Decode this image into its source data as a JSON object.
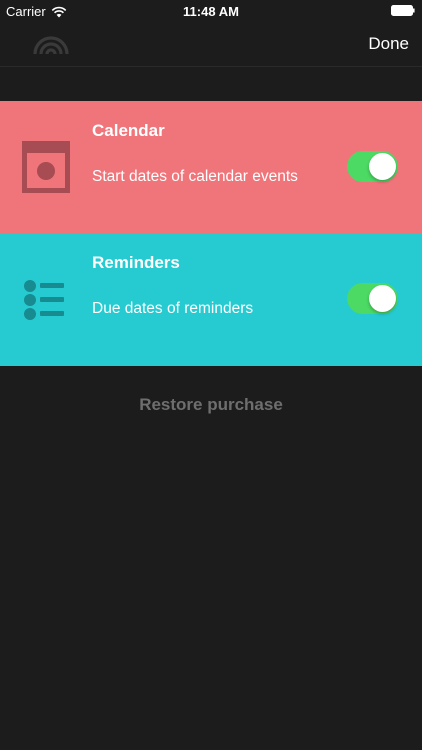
{
  "status_bar": {
    "carrier": "Carrier",
    "time": "11:48 AM"
  },
  "nav": {
    "done_label": "Done"
  },
  "rows": [
    {
      "title": "Calendar",
      "subtitle": "Start dates of calendar events",
      "color": "#f0757a",
      "icon": "calendar-icon",
      "enabled": true
    },
    {
      "title": "Reminders",
      "subtitle": "Due dates of reminders",
      "color": "#25cbd1",
      "icon": "list-icon",
      "enabled": true
    }
  ],
  "restore_label": "Restore purchase",
  "colors": {
    "background": "#1c1c1c",
    "toggle_on": "#4cd964",
    "restore_text": "#6e6e6e"
  }
}
